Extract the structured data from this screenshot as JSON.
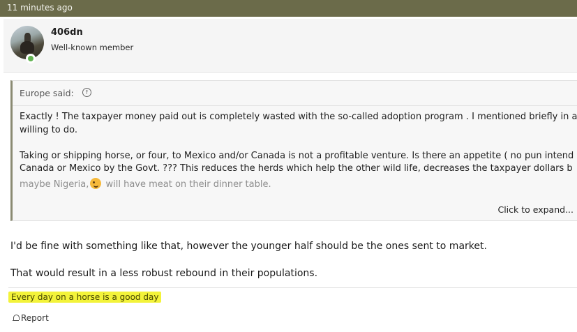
{
  "header": {
    "timestamp": "11 minutes ago"
  },
  "user": {
    "name": "406dn",
    "title": "Well-known member"
  },
  "quote": {
    "author": "Europe said:",
    "lines": [
      "Exactly ! The taxpayer money paid out is completely wasted with the so-called adoption program . I mentioned briefly in a",
      "willing to do.",
      "Taking or shipping horse, or four, to Mexico and/or Canada is not a profitable venture. Is there an appetite ( no pun intend",
      "Canada or Mexico by the Govt. ??? This reduces the herds which help the other wild life, decreases the taxpayer dollars b"
    ],
    "faded_before": "maybe Nigeria,",
    "faded_after": " will have meat on their dinner table.",
    "expand_label": "Click to expand..."
  },
  "post": {
    "line1": "I'd be fine with something like that, however the younger half should be the ones sent to market.",
    "line2": "That would result in a less robust rebound in their populations."
  },
  "signature": "Every day on a horse is a good day",
  "actions": {
    "report": "Report"
  },
  "colors": {
    "header_bg": "#6b6b4a",
    "online": "#63b453",
    "signature_highlight": "#f3f33a"
  },
  "icons": [
    "arrow-up-circle-icon",
    "online-status-icon",
    "wink-emoji-icon",
    "bell-icon"
  ]
}
